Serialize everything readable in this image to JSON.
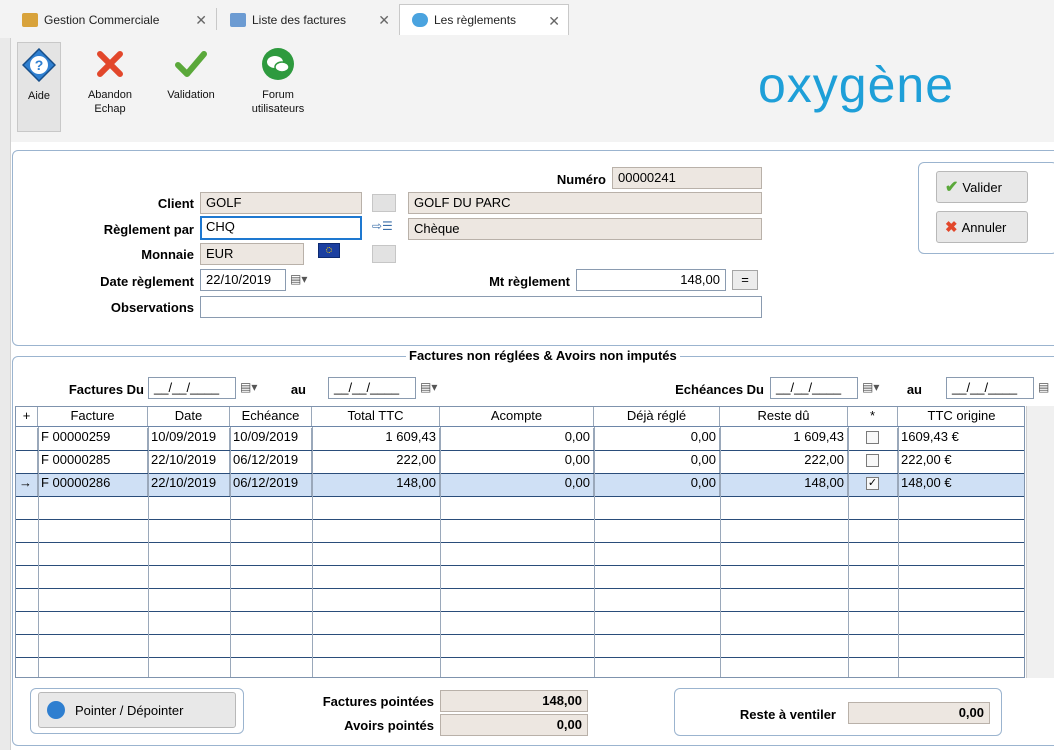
{
  "tabs": [
    {
      "label": "Gestion Commerciale"
    },
    {
      "label": "Liste des factures"
    },
    {
      "label": "Les règlements"
    }
  ],
  "toolbar": {
    "aide": "Aide",
    "abandon_l1": "Abandon",
    "abandon_l2": "Echap",
    "validation": "Validation",
    "forum_l1": "Forum",
    "forum_l2": "utilisateurs"
  },
  "logo": "oxygène",
  "colors": {
    "accent": "#1e9fd8",
    "selected_row": "#cfe0f5",
    "field_bg": "#ede7e1"
  },
  "form": {
    "numero_label": "Numéro",
    "numero_value": "00000241",
    "client_label": "Client",
    "client_code": "GOLF",
    "client_name": "GOLF DU PARC",
    "reglement_label": "Règlement par",
    "reglement_code": "CHQ",
    "reglement_name": "Chèque",
    "monnaie_label": "Monnaie",
    "monnaie_value": "EUR",
    "date_label": "Date règlement",
    "date_value": "22/10/2019",
    "mt_label": "Mt règlement",
    "mt_value": "148,00",
    "eq_label": "=",
    "observations_label": "Observations",
    "observations_value": ""
  },
  "actions": {
    "valider": "Valider",
    "annuler": "Annuler"
  },
  "factures": {
    "title": "Factures non réglées & Avoirs non imputés",
    "du_label": "Factures Du",
    "du_value": "__/__/____",
    "au_label": "au",
    "au_value": "__/__/____",
    "ech_label": "Echéances Du",
    "ech_value": "__/__/____",
    "ech_au_label": "au",
    "ech_au_value": "__/__/____",
    "headers": [
      "+",
      "Facture",
      "Date",
      "Echéance",
      "Total TTC",
      "Acompte",
      "Déjà réglé",
      "Reste dû",
      "*",
      "TTC origine"
    ],
    "rows": [
      {
        "marker": "",
        "facture": "F 00000259",
        "date": "10/09/2019",
        "echeance": "10/09/2019",
        "total": "1 609,43",
        "acompte": "0,00",
        "deja": "0,00",
        "reste": "1 609,43",
        "checked": "",
        "origine": "1609,43 €"
      },
      {
        "marker": "",
        "facture": "F 00000285",
        "date": "22/10/2019",
        "echeance": "06/12/2019",
        "total": "222,00",
        "acompte": "0,00",
        "deja": "0,00",
        "reste": "222,00",
        "checked": "",
        "origine": "222,00 €"
      },
      {
        "marker": "→",
        "facture": "F 00000286",
        "date": "22/10/2019",
        "echeance": "06/12/2019",
        "total": "148,00",
        "acompte": "0,00",
        "deja": "0,00",
        "reste": "148,00",
        "checked": "✓",
        "origine": "148,00 €"
      }
    ]
  },
  "footer": {
    "pointer_label": "Pointer / Dépointer",
    "factures_pointees_label": "Factures pointées",
    "factures_pointees_value": "148,00",
    "avoirs_pointes_label": "Avoirs pointés",
    "avoirs_pointes_value": "0,00",
    "reste_label": "Reste à ventiler",
    "reste_value": "0,00"
  }
}
